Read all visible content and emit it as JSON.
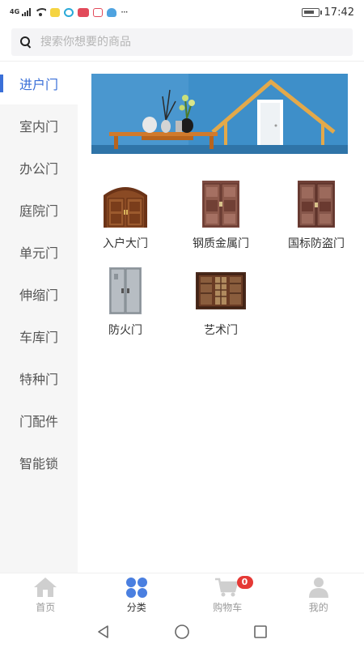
{
  "status_bar": {
    "network": "4G",
    "time": "17:42",
    "more": "···"
  },
  "search": {
    "placeholder": "搜索你想要的商品"
  },
  "sidebar": {
    "items": [
      {
        "label": "进户门",
        "active": true
      },
      {
        "label": "室内门"
      },
      {
        "label": "办公门"
      },
      {
        "label": "庭院门"
      },
      {
        "label": "单元门"
      },
      {
        "label": "伸缩门"
      },
      {
        "label": "车库门"
      },
      {
        "label": "特种门"
      },
      {
        "label": "门配件"
      },
      {
        "label": "智能锁"
      }
    ]
  },
  "products": [
    {
      "label": "入户大门",
      "icon": "entrance-door-icon"
    },
    {
      "label": "钢质金属门",
      "icon": "steel-door-icon"
    },
    {
      "label": "国标防盗门",
      "icon": "security-door-icon"
    },
    {
      "label": "防火门",
      "icon": "fire-door-icon"
    },
    {
      "label": "艺术门",
      "icon": "art-door-icon"
    }
  ],
  "bottom_nav": {
    "items": [
      {
        "label": "首页",
        "icon": "home-icon"
      },
      {
        "label": "分类",
        "icon": "category-icon",
        "active": true
      },
      {
        "label": "购物车",
        "icon": "cart-icon",
        "badge": "0"
      },
      {
        "label": "我的",
        "icon": "profile-icon"
      }
    ]
  },
  "colors": {
    "accent": "#3a6fd8",
    "badge": "#e53935",
    "banner_wall": "#3e8fc9"
  }
}
